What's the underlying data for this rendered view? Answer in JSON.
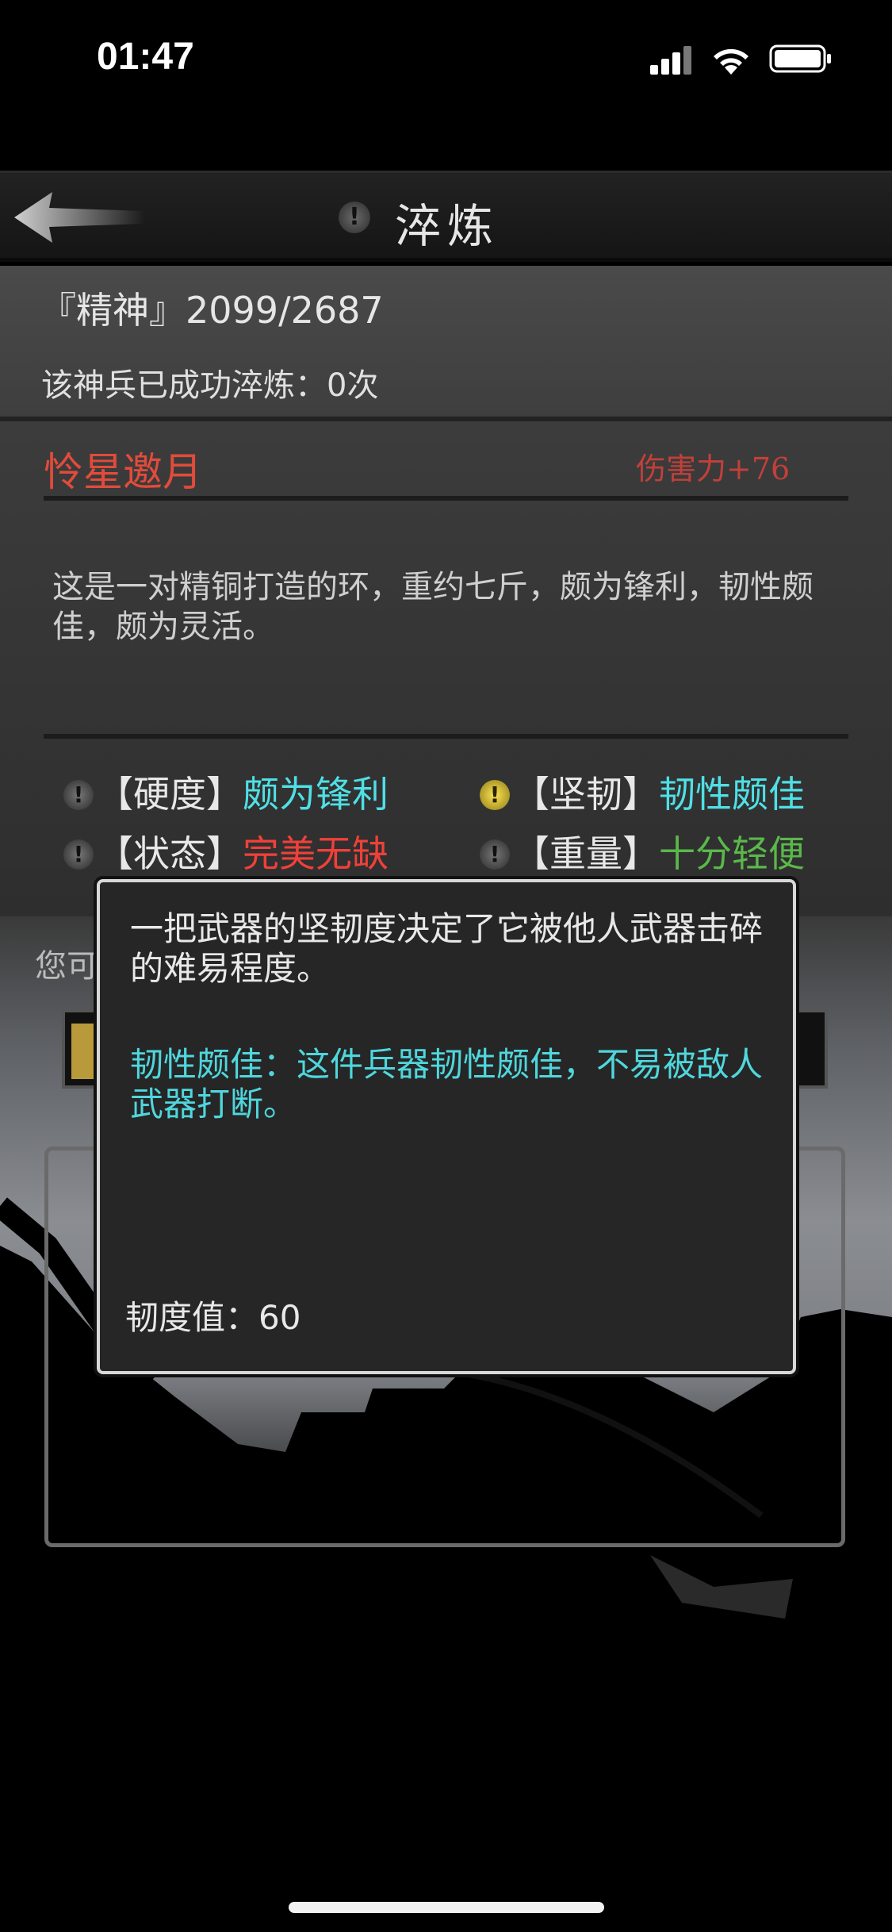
{
  "status": {
    "time": "01:47"
  },
  "header": {
    "title": "淬炼"
  },
  "stats": {
    "spirit": "『精神』2099/2687",
    "refine_count": "该神兵已成功淬炼：0次"
  },
  "weapon": {
    "name": "怜星邀月",
    "damage": "伤害力+76",
    "description": "这是一对精铜打造的环，重约七斤，颇为锋利，韧性颇佳，颇为灵活。"
  },
  "attributes": [
    {
      "label": "【硬度】",
      "value": "颇为锋利"
    },
    {
      "label": "【坚韧】",
      "value": "韧性颇佳"
    },
    {
      "label": "【状态】",
      "value": "完美无缺"
    },
    {
      "label": "【重量】",
      "value": "十分轻便"
    }
  ],
  "background": {
    "hint_partial": "您可"
  },
  "tooltip": {
    "main": "一把武器的坚韧度决定了它被他人武器击碎的难易程度。",
    "detail": "韧性颇佳：这件兵器韧性颇佳，不易被敌人武器打断。",
    "value": "韧度值：60"
  },
  "colors": {
    "cyan": "#4fe0e6",
    "red": "#f0403a",
    "green": "#5ab84a",
    "weapon_name": "#e24b3b"
  }
}
